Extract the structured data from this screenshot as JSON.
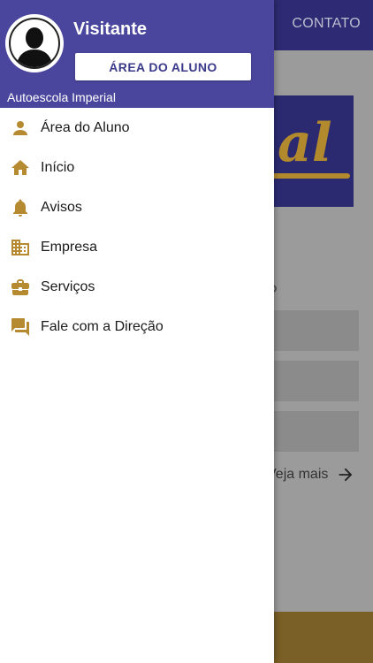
{
  "background": {
    "appbar_contato": "CONTATO",
    "veja_mais": "Veja mais"
  },
  "drawer": {
    "user_name": "Visitante",
    "area_button": "ÁREA DO ALUNO",
    "org_name": "Autoescola Imperial",
    "items": [
      {
        "label": "Área do Aluno",
        "icon": "person-icon"
      },
      {
        "label": "Início",
        "icon": "home-icon"
      },
      {
        "label": "Avisos",
        "icon": "bell-icon"
      },
      {
        "label": "Empresa",
        "icon": "building-icon"
      },
      {
        "label": "Serviços",
        "icon": "briefcase-icon"
      },
      {
        "label": "Fale com a Direção",
        "icon": "chat-icon"
      }
    ]
  },
  "colors": {
    "header": "#4b469d",
    "accent_gold": "#b58a30",
    "appbar": "#2e2a73"
  }
}
